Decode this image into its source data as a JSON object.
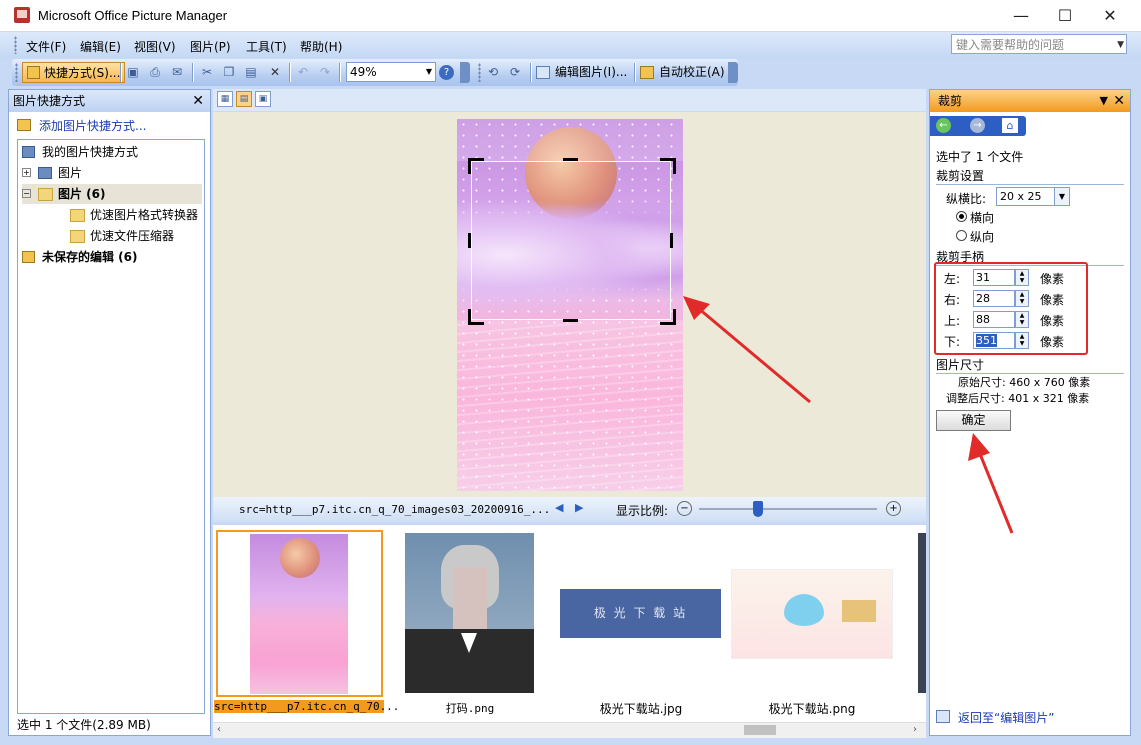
{
  "window": {
    "title": "Microsoft Office Picture Manager",
    "minimize_glyph": "—",
    "maximize_glyph": "☐",
    "close_glyph": "✕"
  },
  "menu": {
    "items": [
      "文件(F)",
      "编辑(E)",
      "视图(V)",
      "图片(P)",
      "工具(T)",
      "帮助(H)"
    ],
    "help_placeholder": "键入需要帮助的问题"
  },
  "toolbar": {
    "shortcuts_label": "快捷方式(S)...",
    "zoom_value": "49%",
    "edit_pictures_label": "编辑图片(I)...",
    "auto_correct_label": "自动校正(A)"
  },
  "left_panel": {
    "title": "图片快捷方式",
    "add_shortcut": "添加图片快捷方式...",
    "tree": {
      "root": "我的图片快捷方式",
      "pictures": "图片",
      "pictures_selected": "图片 (6)",
      "folder1": "优速图片格式转换器",
      "folder2": "优速文件压缩器",
      "unsaved": "未保存的编辑 (6)"
    },
    "status": "选中 1 个文件(2.89 MB)"
  },
  "center": {
    "filename": "src=http___p7.itc.cn_q_70_images03_20200916_...",
    "zoom_label": "显示比例:",
    "zoom_fraction": 0.32
  },
  "thumbnails": [
    {
      "caption": "src=http___p7.itc.cn_q_70..."
    },
    {
      "caption": "打码.png"
    },
    {
      "caption": "极光下载站.jpg",
      "banner_text": "极 光 下 载 站"
    },
    {
      "caption": "极光下载站.png"
    }
  ],
  "right_panel": {
    "title": "裁剪",
    "selected": "选中了 1 个文件",
    "crop_settings": "裁剪设置",
    "aspect_label": "纵横比:",
    "aspect_value": "20 x 25",
    "landscape": "横向",
    "portrait": "纵向",
    "handles_label": "裁剪手柄",
    "left_label": "左:",
    "left_value": "31",
    "right_label": "右:",
    "right_value": "28",
    "top_label": "上:",
    "top_value": "88",
    "bottom_label": "下:",
    "bottom_value": "351",
    "unit": "像素",
    "size_header": "图片尺寸",
    "original_size": "原始尺寸: 460 x 760 像素",
    "adjusted_size": "调整后尺寸: 401 x 321 像素",
    "ok": "确定",
    "back_link": "返回至“编辑图片”"
  },
  "colors": {
    "accent_red": "#e12a2a",
    "panel_header_orange": "#f39a1e",
    "frame_blue": "#c7d9f4"
  }
}
